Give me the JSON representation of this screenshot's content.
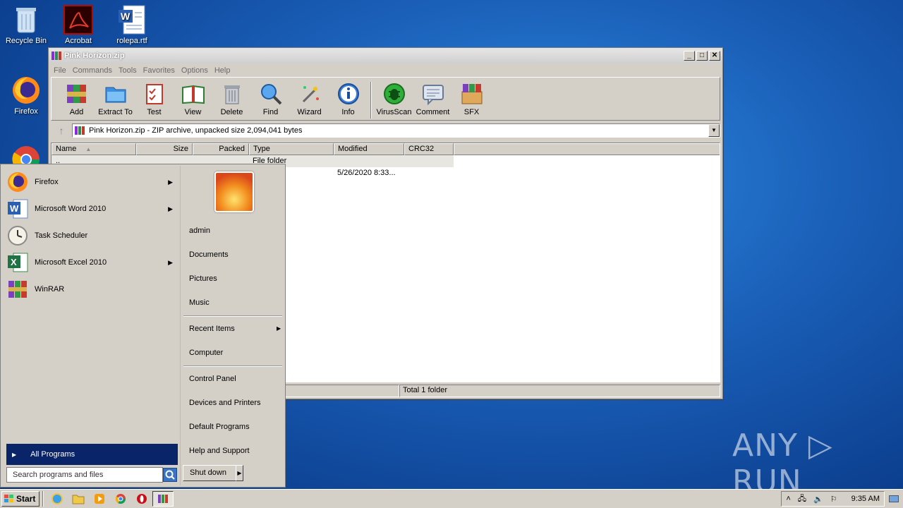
{
  "desktop": {
    "icons": [
      {
        "label": "Recycle Bin",
        "icon": "recycle-bin-icon"
      },
      {
        "label": "Acrobat",
        "icon": "acrobat-icon"
      },
      {
        "label": "rolepa.rtf",
        "icon": "word-document-icon"
      },
      {
        "label": "Firefox",
        "icon": "firefox-icon"
      },
      {
        "label": "",
        "icon": "chrome-icon"
      }
    ],
    "watermark": "ANY ▷ RUN"
  },
  "winrar": {
    "title": "Pink Horizon.zip",
    "menu": [
      "File",
      "Commands",
      "Tools",
      "Favorites",
      "Options",
      "Help"
    ],
    "toolbar": [
      "Add",
      "Extract To",
      "Test",
      "View",
      "Delete",
      "Find",
      "Wizard",
      "Info",
      "VirusScan",
      "Comment",
      "SFX"
    ],
    "path": "Pink Horizon.zip - ZIP archive, unpacked size 2,094,041 bytes",
    "columns": [
      "Name",
      "Size",
      "Packed",
      "Type",
      "Modified",
      "CRC32"
    ],
    "rows": [
      {
        "name": "..",
        "type": "File folder",
        "modified": ""
      },
      {
        "name": "",
        "type": "",
        "modified": "5/26/2020 8:33..."
      }
    ],
    "status": "Total 1 folder"
  },
  "startmenu": {
    "programs": [
      {
        "label": "Firefox",
        "icon": "firefox-icon",
        "submenu": true
      },
      {
        "label": "Microsoft Word 2010",
        "icon": "word-icon",
        "submenu": true
      },
      {
        "label": "Task Scheduler",
        "icon": "clock-icon",
        "submenu": false
      },
      {
        "label": "Microsoft Excel 2010",
        "icon": "excel-icon",
        "submenu": true
      },
      {
        "label": "WinRAR",
        "icon": "winrar-icon",
        "submenu": false
      }
    ],
    "all_programs": "All Programs",
    "search_placeholder": "Search programs and files",
    "right": [
      "admin",
      "Documents",
      "Pictures",
      "Music",
      "Recent Items",
      "Computer",
      "Control Panel",
      "Devices and Printers",
      "Default Programs",
      "Help and Support"
    ],
    "shutdown": "Shut down"
  },
  "taskbar": {
    "start": "Start",
    "clock": "9:35 AM"
  },
  "colors": {
    "accent": "#0a246a",
    "desktop": "#1a5fb8"
  }
}
